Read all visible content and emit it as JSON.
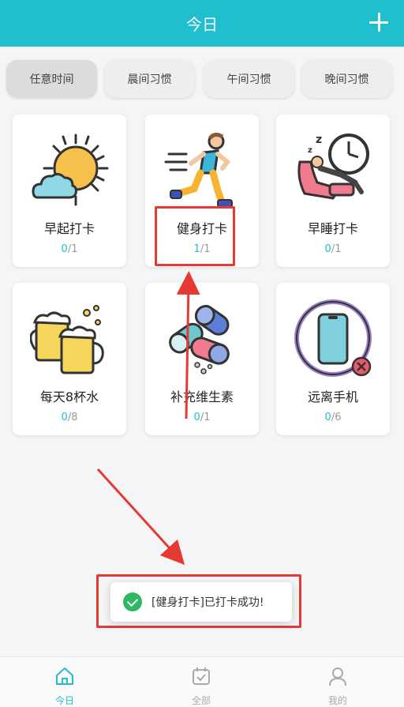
{
  "header": {
    "title": "今日"
  },
  "tabs": [
    {
      "label": "任意时间",
      "active": true
    },
    {
      "label": "晨间习惯",
      "active": false
    },
    {
      "label": "午间习惯",
      "active": false
    },
    {
      "label": "晚间习惯",
      "active": false
    }
  ],
  "habits": [
    {
      "name": "早起打卡",
      "done": "0",
      "total": "/1",
      "icon": "sun-cloud-icon"
    },
    {
      "name": "健身打卡",
      "done": "1",
      "total": "/1",
      "icon": "runner-icon"
    },
    {
      "name": "早睡打卡",
      "done": "0",
      "total": "/1",
      "icon": "sleep-clock-icon"
    },
    {
      "name": "每天8杯水",
      "done": "0",
      "total": "/8",
      "icon": "beer-mugs-icon"
    },
    {
      "name": "补充维生素",
      "done": "0",
      "total": "/1",
      "icon": "pills-icon"
    },
    {
      "name": "远离手机",
      "done": "0",
      "total": "/6",
      "icon": "no-phone-icon"
    }
  ],
  "toast": {
    "message": "[健身打卡]已打卡成功!"
  },
  "tabbar": [
    {
      "label": "今日",
      "active": true
    },
    {
      "label": "全部",
      "active": false
    },
    {
      "label": "我的",
      "active": false
    }
  ],
  "colors": {
    "accent": "#1fbfd0",
    "annotation": "#e43a33",
    "success": "#2db864"
  }
}
